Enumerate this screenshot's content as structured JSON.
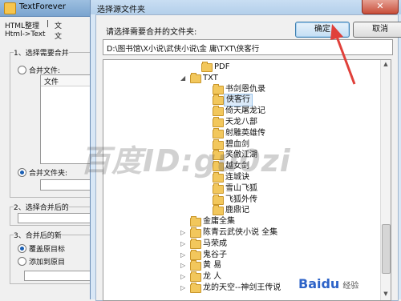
{
  "main_window": {
    "title": "TextForever",
    "tabs": [
      "HTML整理",
      "|",
      "文",
      "Html->Text",
      "文"
    ],
    "section1_legend": "1、选择需要合并",
    "option_merge_files": "合并文件:",
    "list_header": "文件",
    "option_merge_folder": "合并文件夹:",
    "section2_legend": "2、选择合并后的",
    "section3_legend": "3、合并后的新",
    "option_overwrite": "覆盖原目标",
    "option_append": "添加到原目"
  },
  "dialog": {
    "title": "选择源文件夹",
    "close_glyph": "✕",
    "prompt": "请选择需要合并的文件夹:",
    "ok_label": "确定",
    "cancel_label": "取消",
    "path": "D:\\图书馆\\X小说\\武侠小说\\金  庸\\TXT\\侠客行",
    "tree": [
      {
        "label": "PDF",
        "expander": ""
      },
      {
        "label": "TXT",
        "expander": "◢"
      },
      {
        "label": "书剑恩仇录",
        "expander": ""
      },
      {
        "label": "侠客行",
        "expander": "",
        "selected": true
      },
      {
        "label": "倚天屠龙记",
        "expander": ""
      },
      {
        "label": "天龙八部",
        "expander": ""
      },
      {
        "label": "射雕英雄传",
        "expander": ""
      },
      {
        "label": "碧血剑",
        "expander": ""
      },
      {
        "label": "笑傲江湖",
        "expander": ""
      },
      {
        "label": "越女剑",
        "expander": ""
      },
      {
        "label": "连城诀",
        "expander": ""
      },
      {
        "label": "雪山飞狐",
        "expander": ""
      },
      {
        "label": "飞狐外传",
        "expander": ""
      },
      {
        "label": "鹿鼎记",
        "expander": ""
      },
      {
        "label": "金庸全集",
        "expander": ""
      },
      {
        "label": "陈青云武侠小说 全集",
        "expander": "▷"
      },
      {
        "label": "马荣成",
        "expander": "▷"
      },
      {
        "label": "鬼谷子",
        "expander": "▷"
      },
      {
        "label": "黄  易",
        "expander": "▷"
      },
      {
        "label": "龙  人",
        "expander": "▷"
      },
      {
        "label": "龙的天空--神剑王传说",
        "expander": "▷"
      }
    ]
  },
  "watermark": "百度ID:gu0zi",
  "baidu_logo": {
    "text": "Baidu",
    "sub": "经验"
  },
  "colors": {
    "accent_arrow": "#e0403a",
    "selection": "#dbeaf9"
  }
}
